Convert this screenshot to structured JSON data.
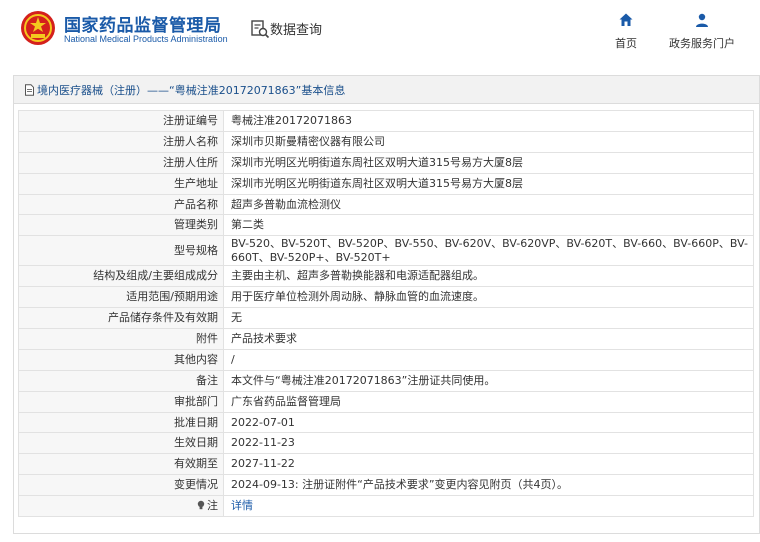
{
  "header": {
    "org_cn": "国家药品监督管理局",
    "org_en": "National Medical Products Administration",
    "query_label": "数据查询",
    "nav": [
      {
        "label": "首页",
        "icon": "home-icon"
      },
      {
        "label": "政务服务门户",
        "icon": "user-icon"
      }
    ]
  },
  "colors": {
    "brand": "#1a5aa8",
    "emblem_red": "#d4201c",
    "emblem_gold": "#f4c81e"
  },
  "panel": {
    "title": "境内医疗器械（注册）——“粤械注准20172071863”基本信息"
  },
  "rows": [
    {
      "key": "注册证编号",
      "value": "粤械注准20172071863"
    },
    {
      "key": "注册人名称",
      "value": "深圳市贝斯曼精密仪器有限公司"
    },
    {
      "key": "注册人住所",
      "value": "深圳市光明区光明街道东周社区双明大道315号易方大厦8层"
    },
    {
      "key": "生产地址",
      "value": "深圳市光明区光明街道东周社区双明大道315号易方大厦8层"
    },
    {
      "key": "产品名称",
      "value": "超声多普勒血流检测仪"
    },
    {
      "key": "管理类别",
      "value": "第二类"
    },
    {
      "key": "型号规格",
      "value": "BV-520、BV-520T、BV-520P、BV-550、BV-620V、BV-620VP、BV-620T、BV-660、BV-660P、BV-660T、BV-520P+、BV-520T+"
    },
    {
      "key": "结构及组成/主要组成成分",
      "value": "主要由主机、超声多普勒换能器和电源适配器组成。"
    },
    {
      "key": "适用范围/预期用途",
      "value": "用于医疗单位检测外周动脉、静脉血管的血流速度。"
    },
    {
      "key": "产品储存条件及有效期",
      "value": "无"
    },
    {
      "key": "附件",
      "value": "产品技术要求"
    },
    {
      "key": "其他内容",
      "value": "/"
    },
    {
      "key": "备注",
      "value": "本文件与“粤械注准20172071863”注册证共同使用。"
    },
    {
      "key": "审批部门",
      "value": "广东省药品监督管理局"
    },
    {
      "key": "批准日期",
      "value": "2022-07-01"
    },
    {
      "key": "生效日期",
      "value": "2022-11-23"
    },
    {
      "key": "有效期至",
      "value": "2027-11-22"
    },
    {
      "key": "变更情况",
      "value": "2024-09-13: 注册证附件“产品技术要求”变更内容见附页（共4页）。"
    }
  ],
  "note_row": {
    "key": "注",
    "link": "详情",
    "icon": "lightbulb-icon"
  }
}
